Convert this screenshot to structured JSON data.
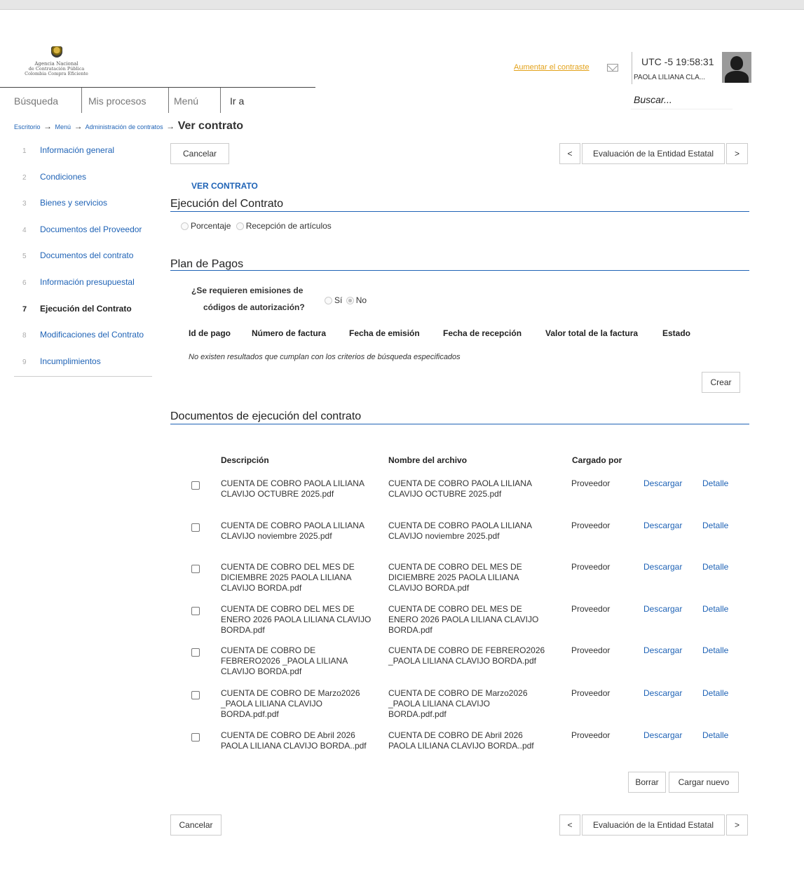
{
  "logo": {
    "line1": "Agencia Nacional",
    "line2": "de Contratación Pública",
    "line3": "Colombia Compra Eficiente"
  },
  "header": {
    "contrast_link": "Aumentar el contraste",
    "clock": "UTC -5 19:58:31",
    "user_name": "PAOLA LILIANA CLA...",
    "search_placeholder": "Buscar..."
  },
  "nav": [
    "Búsqueda",
    "Mis procesos",
    "Menú",
    "Ir a"
  ],
  "breadcrumb": {
    "items": [
      "Escritorio",
      "Menú",
      "Administración de contratos"
    ],
    "current": "Ver contrato"
  },
  "sidebar": [
    {
      "num": "1",
      "label": "Información general"
    },
    {
      "num": "2",
      "label": "Condiciones"
    },
    {
      "num": "3",
      "label": "Bienes y servicios"
    },
    {
      "num": "4",
      "label": "Documentos del Proveedor"
    },
    {
      "num": "5",
      "label": "Documentos del contrato"
    },
    {
      "num": "6",
      "label": "Información presupuestal"
    },
    {
      "num": "7",
      "label": "Ejecución del Contrato",
      "active": true
    },
    {
      "num": "8",
      "label": "Modificaciones del Contrato"
    },
    {
      "num": "9",
      "label": "Incumplimientos"
    }
  ],
  "buttons": {
    "cancel": "Cancelar",
    "prev": "<",
    "next": ">",
    "evaluation": "Evaluación de la Entidad Estatal",
    "create": "Crear",
    "delete": "Borrar",
    "upload": "Cargar nuevo"
  },
  "view_title": "VER CONTRATO",
  "execution": {
    "title": "Ejecución del Contrato",
    "option1": "Porcentaje",
    "option2": "Recepción de artículos"
  },
  "payments": {
    "title": "Plan de Pagos",
    "question_line1": "¿Se requieren emisiones de",
    "question_line2": "códigos de autorización?",
    "yes": "Sí",
    "no": "No",
    "selected": "No",
    "columns": [
      "Id de pago",
      "Número de factura",
      "Fecha de emisión",
      "Fecha de recepción",
      "Valor total de la factura",
      "Estado"
    ],
    "empty_message": "No existen resultados que cumplan con los criterios de búsqueda especificados"
  },
  "documents": {
    "title": "Documentos de ejecución del contrato",
    "columns": {
      "description": "Descripción",
      "filename": "Nombre del archivo",
      "uploaded_by": "Cargado por"
    },
    "download_label": "Descargar",
    "detail_label": "Detalle",
    "rows": [
      {
        "description": "CUENTA DE COBRO PAOLA LILIANA CLAVIJO OCTUBRE 2025.pdf",
        "filename": "CUENTA DE COBRO PAOLA LILIANA CLAVIJO OCTUBRE 2025.pdf",
        "uploaded_by": "Proveedor"
      },
      {
        "description": "CUENTA DE COBRO PAOLA LILIANA CLAVIJO noviembre 2025.pdf",
        "filename": "CUENTA DE COBRO PAOLA LILIANA CLAVIJO noviembre 2025.pdf",
        "uploaded_by": "Proveedor"
      },
      {
        "description": "CUENTA DE COBRO DEL MES DE DICIEMBRE 2025 PAOLA LILIANA CLAVIJO BORDA.pdf",
        "filename": "CUENTA DE COBRO DEL MES DE DICIEMBRE 2025 PAOLA LILIANA CLAVIJO BORDA.pdf",
        "uploaded_by": "Proveedor"
      },
      {
        "description": "CUENTA DE COBRO DEL MES DE ENERO 2026 PAOLA LILIANA CLAVIJO BORDA.pdf",
        "filename": "CUENTA DE COBRO DEL MES DE ENERO 2026 PAOLA LILIANA CLAVIJO BORDA.pdf",
        "uploaded_by": "Proveedor"
      },
      {
        "description": "CUENTA DE COBRO DE FEBRERO2026 _PAOLA LILIANA CLAVIJO BORDA.pdf",
        "filename": "CUENTA DE COBRO DE FEBRERO2026 _PAOLA LILIANA CLAVIJO BORDA.pdf",
        "uploaded_by": "Proveedor"
      },
      {
        "description": "CUENTA DE COBRO DE Marzo2026 _PAOLA LILIANA CLAVIJO BORDA.pdf.pdf",
        "filename": "CUENTA DE COBRO DE Marzo2026 _PAOLA LILIANA CLAVIJO BORDA.pdf.pdf",
        "uploaded_by": "Proveedor"
      },
      {
        "description": "CUENTA DE COBRO DE Abril 2026 PAOLA LILIANA CLAVIJO BORDA..pdf",
        "filename": "CUENTA DE COBRO DE Abril 2026 PAOLA LILIANA CLAVIJO BORDA..pdf",
        "uploaded_by": "Proveedor"
      }
    ]
  },
  "colors": {
    "link": "#1f63b6",
    "contrast_link": "#e3a21a",
    "rule": "#1f63b6"
  }
}
